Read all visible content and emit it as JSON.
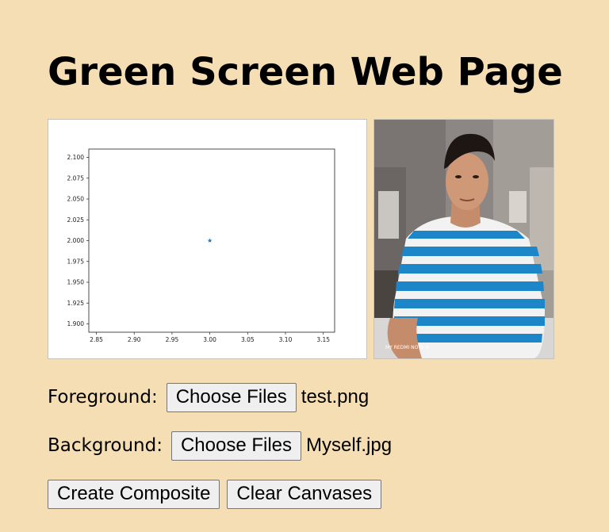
{
  "page": {
    "title": "Green Screen Web Page"
  },
  "foreground": {
    "label": "Foreground:",
    "button_label": "Choose Files",
    "file_name": "test.png"
  },
  "background": {
    "label": "Background:",
    "button_label": "Choose Files",
    "file_name": "Myself.jpg"
  },
  "actions": {
    "create_label": "Create Composite",
    "clear_label": "Clear Canvases"
  },
  "foreground_plot": {
    "type": "scatter",
    "x": [
      3.0
    ],
    "y": [
      2.0
    ],
    "marker": "star",
    "marker_color": "#1f77b4",
    "xlim": [
      2.84,
      3.165
    ],
    "ylim": [
      1.89,
      2.11
    ],
    "x_ticks": [
      "2.85",
      "2.90",
      "2.95",
      "3.00",
      "3.05",
      "3.10",
      "3.15"
    ],
    "y_ticks": [
      "2.100",
      "2.075",
      "2.050",
      "2.025",
      "2.000",
      "1.975",
      "1.950",
      "1.925",
      "1.900"
    ]
  },
  "background_image": {
    "description_icon": "photo-of-person",
    "watermark": "MY REDMI NOTE 4"
  },
  "colors": {
    "page_background": "#f5deb3",
    "shirt_blue": "#1c86c8"
  }
}
